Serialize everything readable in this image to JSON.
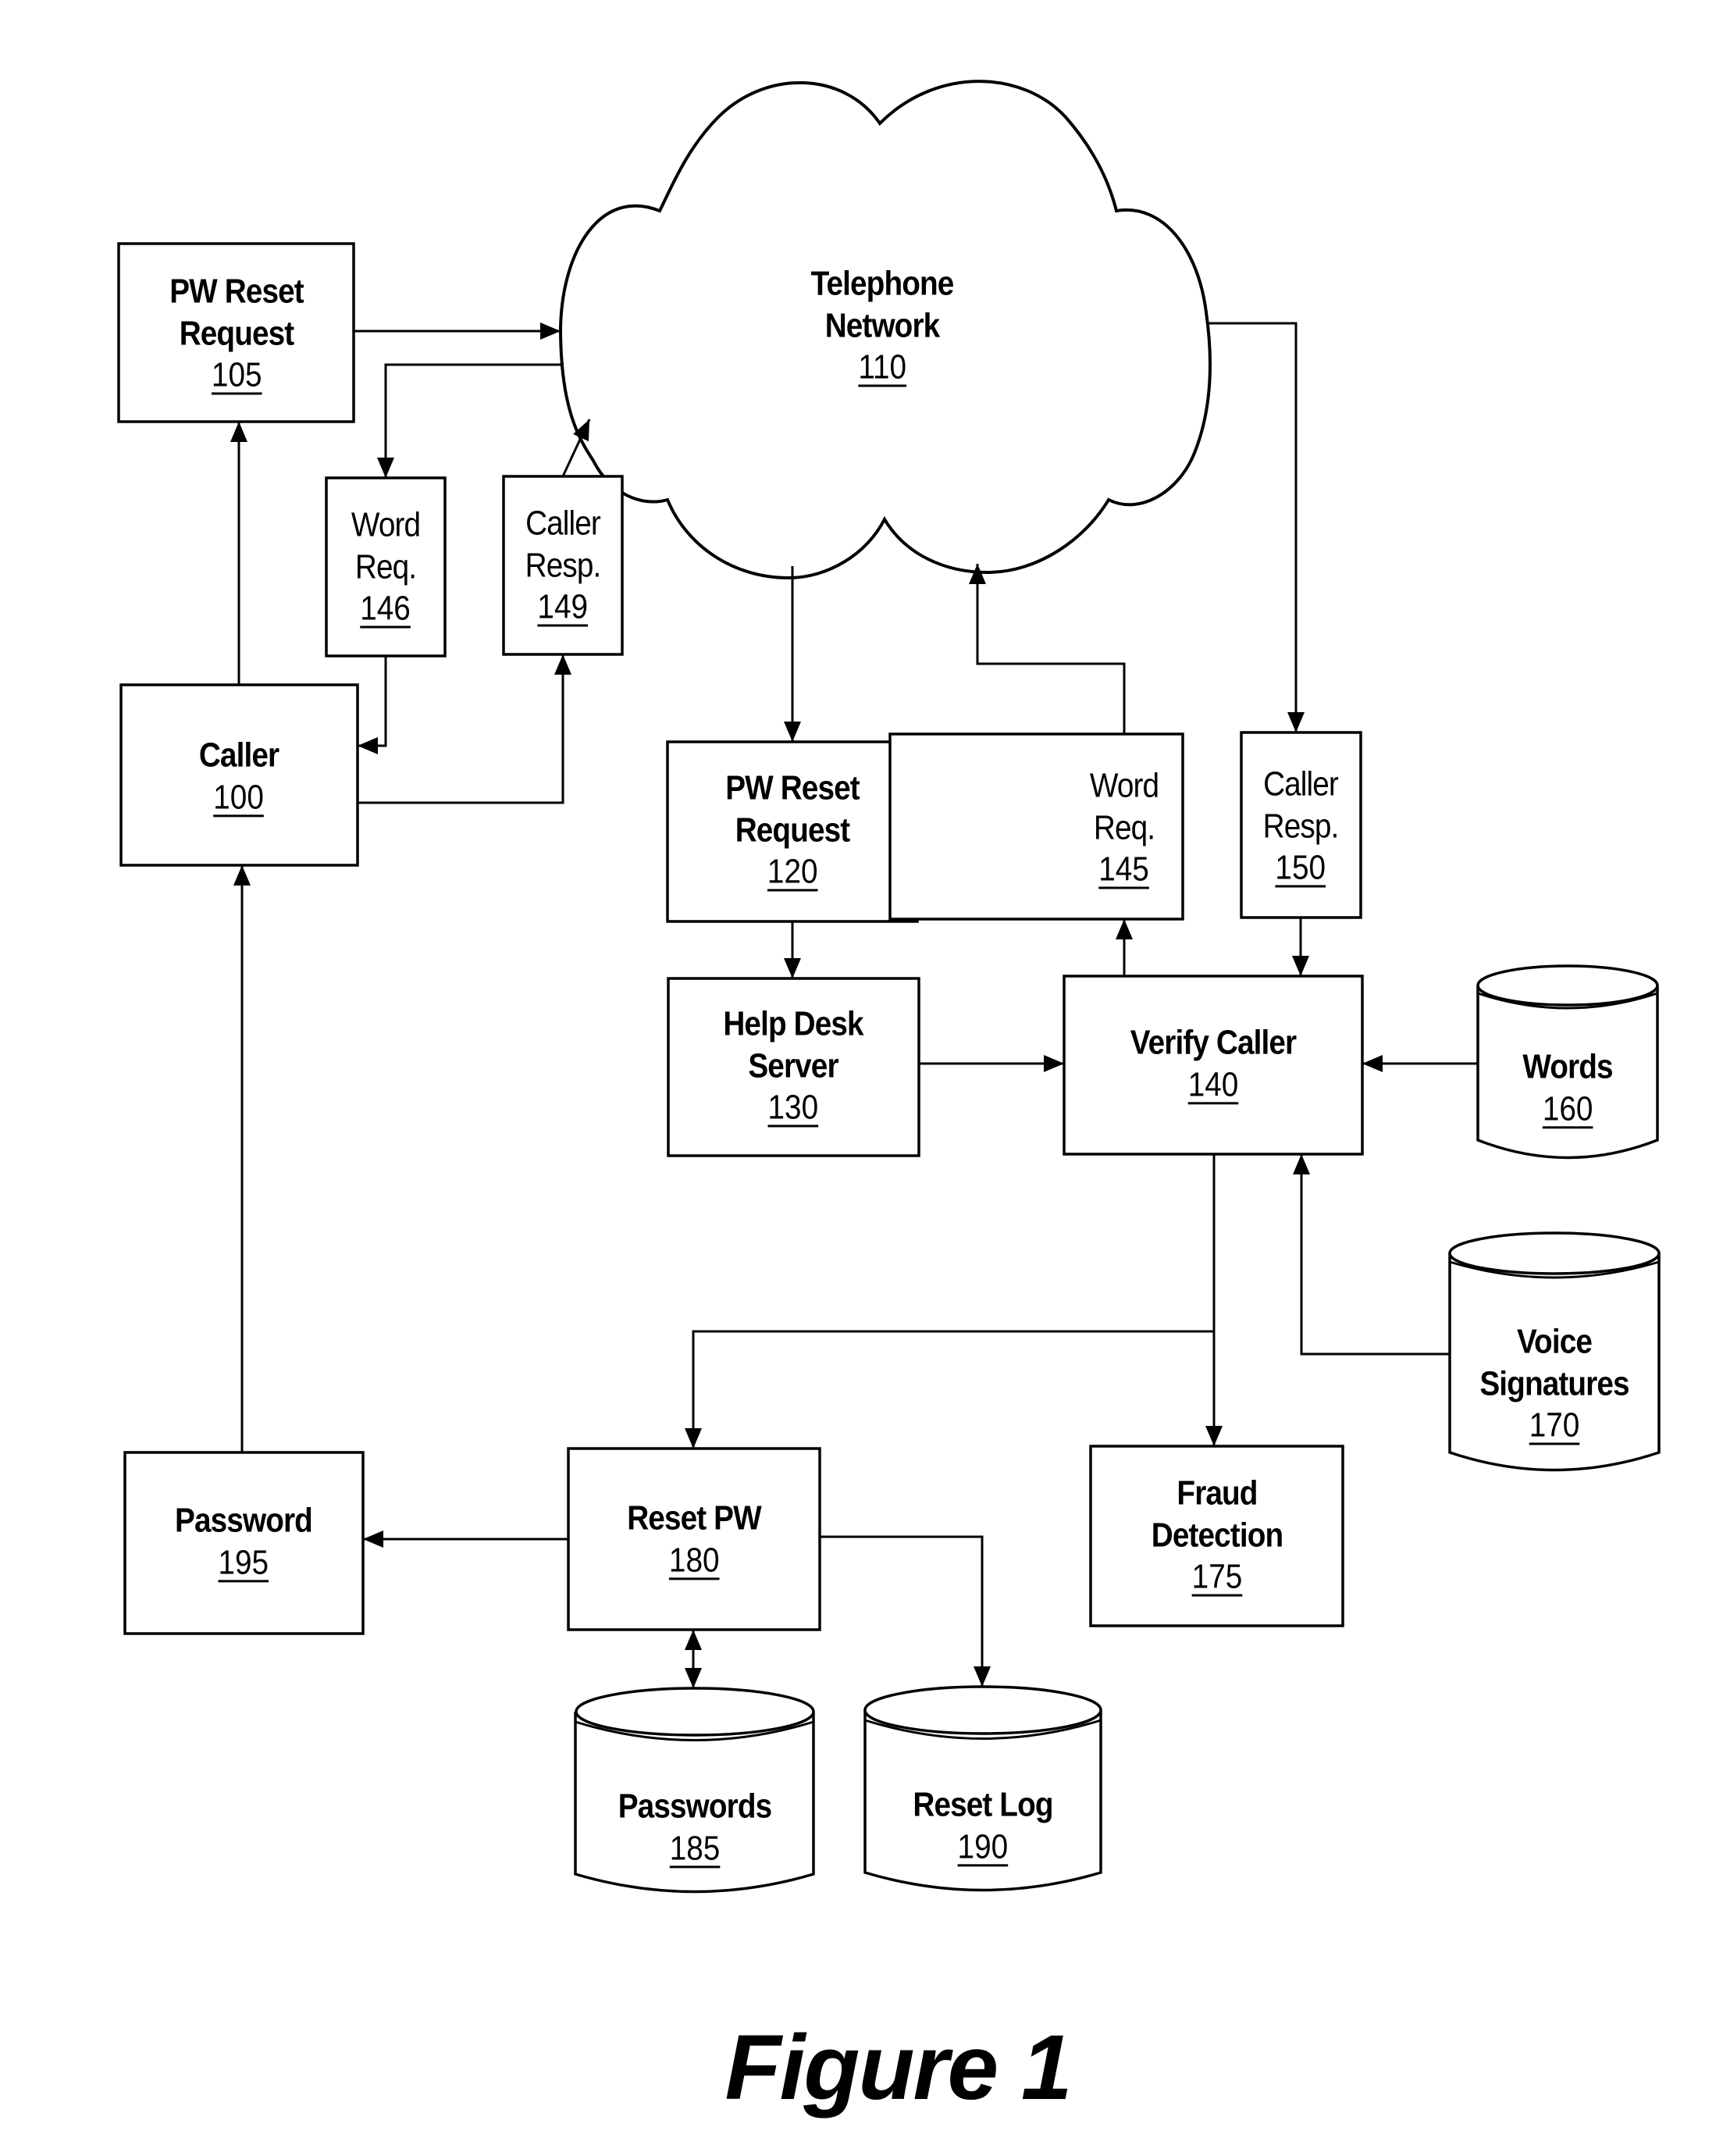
{
  "figure": {
    "caption": "Figure 1"
  },
  "nodes": {
    "pw_reset_request_105": {
      "lines": [
        "PW Reset",
        "Request"
      ],
      "ref": "105",
      "shape": "box"
    },
    "telephone_network_110": {
      "lines": [
        "Telephone",
        "Network"
      ],
      "ref": "110",
      "shape": "cloud"
    },
    "word_req_146": {
      "lines": [
        "Word",
        "Req."
      ],
      "ref": "146",
      "shape": "box"
    },
    "caller_resp_149": {
      "lines": [
        "Caller",
        "Resp."
      ],
      "ref": "149",
      "shape": "box"
    },
    "caller_100": {
      "lines": [
        "Caller"
      ],
      "ref": "100",
      "shape": "box"
    },
    "pw_reset_request_120": {
      "lines": [
        "PW Reset",
        "Request"
      ],
      "ref": "120",
      "shape": "box"
    },
    "word_req_145": {
      "lines": [
        "Word",
        "Req."
      ],
      "ref": "145",
      "shape": "box"
    },
    "caller_resp_150": {
      "lines": [
        "Caller",
        "Resp."
      ],
      "ref": "150",
      "shape": "box"
    },
    "help_desk_server_130": {
      "lines": [
        "Help Desk",
        "Server"
      ],
      "ref": "130",
      "shape": "box"
    },
    "verify_caller_140": {
      "lines": [
        "Verify Caller"
      ],
      "ref": "140",
      "shape": "box"
    },
    "words_160": {
      "lines": [
        "Words"
      ],
      "ref": "160",
      "shape": "database"
    },
    "voice_signatures_170": {
      "lines": [
        "Voice",
        "Signatures"
      ],
      "ref": "170",
      "shape": "database"
    },
    "password_195": {
      "lines": [
        "Password"
      ],
      "ref": "195",
      "shape": "box"
    },
    "reset_pw_180": {
      "lines": [
        "Reset PW"
      ],
      "ref": "180",
      "shape": "box"
    },
    "fraud_detection_175": {
      "lines": [
        "Fraud",
        "Detection"
      ],
      "ref": "175",
      "shape": "box"
    },
    "passwords_185": {
      "lines": [
        "Passwords"
      ],
      "ref": "185",
      "shape": "database"
    },
    "reset_log_190": {
      "lines": [
        "Reset Log"
      ],
      "ref": "190",
      "shape": "database"
    }
  },
  "edges": [
    {
      "from": "pw_reset_request_105",
      "to": "telephone_network_110"
    },
    {
      "from": "telephone_network_110",
      "to": "word_req_146"
    },
    {
      "from": "word_req_146",
      "to": "caller_100"
    },
    {
      "from": "caller_100",
      "to": "caller_resp_149"
    },
    {
      "from": "caller_resp_149",
      "to": "telephone_network_110"
    },
    {
      "from": "caller_100",
      "to": "pw_reset_request_105"
    },
    {
      "from": "telephone_network_110",
      "to": "pw_reset_request_120"
    },
    {
      "from": "pw_reset_request_120",
      "to": "help_desk_server_130"
    },
    {
      "from": "help_desk_server_130",
      "to": "verify_caller_140"
    },
    {
      "from": "verify_caller_140",
      "to": "word_req_145"
    },
    {
      "from": "word_req_145",
      "to": "telephone_network_110"
    },
    {
      "from": "telephone_network_110",
      "to": "caller_resp_150"
    },
    {
      "from": "caller_resp_150",
      "to": "verify_caller_140"
    },
    {
      "from": "words_160",
      "to": "verify_caller_140"
    },
    {
      "from": "voice_signatures_170",
      "to": "verify_caller_140"
    },
    {
      "from": "verify_caller_140",
      "to": "reset_pw_180"
    },
    {
      "from": "verify_caller_140",
      "to": "fraud_detection_175"
    },
    {
      "from": "reset_pw_180",
      "to": "password_195"
    },
    {
      "from": "password_195",
      "to": "caller_100"
    },
    {
      "from": "reset_pw_180",
      "to": "passwords_185",
      "bidirectional": true
    },
    {
      "from": "reset_pw_180",
      "to": "reset_log_190"
    }
  ]
}
